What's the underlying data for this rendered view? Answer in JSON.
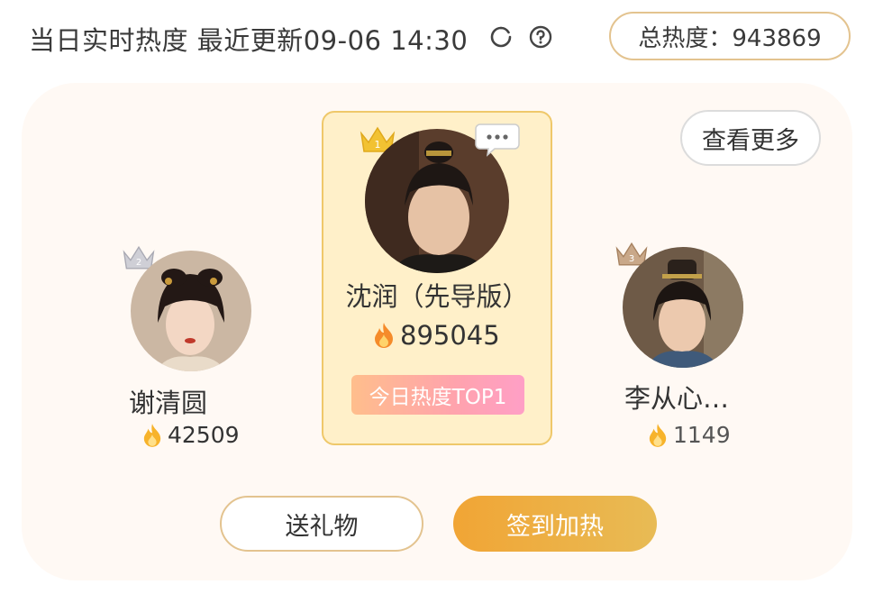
{
  "header": {
    "title": "当日实时热度 最近更新09-06 14:30",
    "total_label": "总热度：943869"
  },
  "panel": {
    "more_label": "查看更多"
  },
  "ranking": [
    {
      "rank": "1",
      "name": "沈润（先导版）",
      "score": "895045",
      "badge": "今日热度TOP1"
    },
    {
      "rank": "2",
      "name": "谢清圆",
      "score": "42509"
    },
    {
      "rank": "3",
      "name": "李从心…",
      "score": "1149"
    }
  ],
  "actions": {
    "gift_label": "送礼物",
    "checkin_label": "签到加热"
  },
  "colors": {
    "gold_border": "#e3c38f",
    "card_bg": "#fff0c9",
    "checkin_gradient_start": "#f1a535",
    "checkin_gradient_end": "#e8bb55",
    "flame": "#f59a23"
  },
  "icons": [
    "refresh-icon",
    "help-icon",
    "crown-icon",
    "more-options-icon",
    "flame-icon"
  ]
}
